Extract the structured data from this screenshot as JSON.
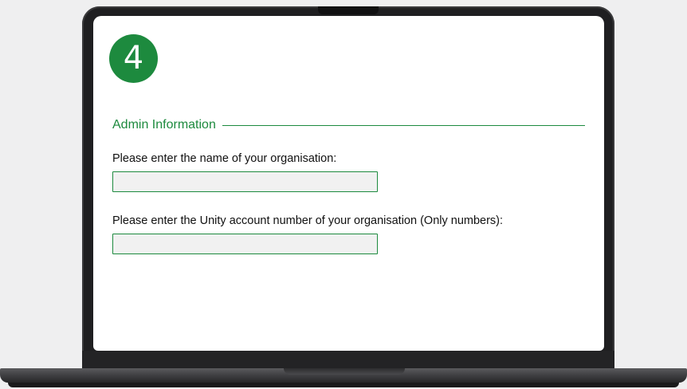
{
  "step": {
    "number": "4"
  },
  "section": {
    "title": "Admin Information"
  },
  "fields": {
    "organisation_name": {
      "label": "Please enter the name of your organisation:",
      "value": ""
    },
    "account_number": {
      "label": "Please enter the Unity account number of your organisation (Only numbers):",
      "value": ""
    }
  },
  "colors": {
    "accent": "#1d8a3e",
    "field_background": "#f1f1f1",
    "page_background": "#efeff0",
    "bezel": "#1f1f21"
  }
}
